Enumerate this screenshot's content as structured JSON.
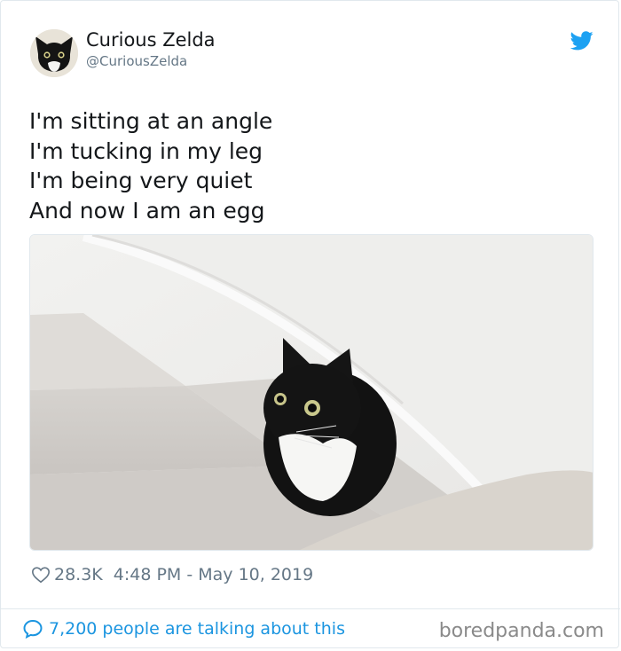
{
  "author": {
    "display_name": "Curious Zelda",
    "handle": "@CuriousZelda",
    "avatar_icon": "black-cat-avatar"
  },
  "platform_icon": "twitter-bird-icon",
  "tweet": {
    "lines": [
      "I'm sitting at an angle",
      "I'm tucking in my leg",
      "I'm being very quiet",
      "And now I am an egg"
    ],
    "image_subject": "black-and-white-cat-on-stairs"
  },
  "meta": {
    "likes": "28.3K",
    "timestamp": "4:48 PM - May 10, 2019"
  },
  "footer": {
    "talking_text": "7,200 people are talking about this",
    "watermark": "boredpanda.com"
  },
  "colors": {
    "accent_blue": "#1da1f2",
    "link_blue": "#1b95e0",
    "meta_gray": "#657786"
  }
}
